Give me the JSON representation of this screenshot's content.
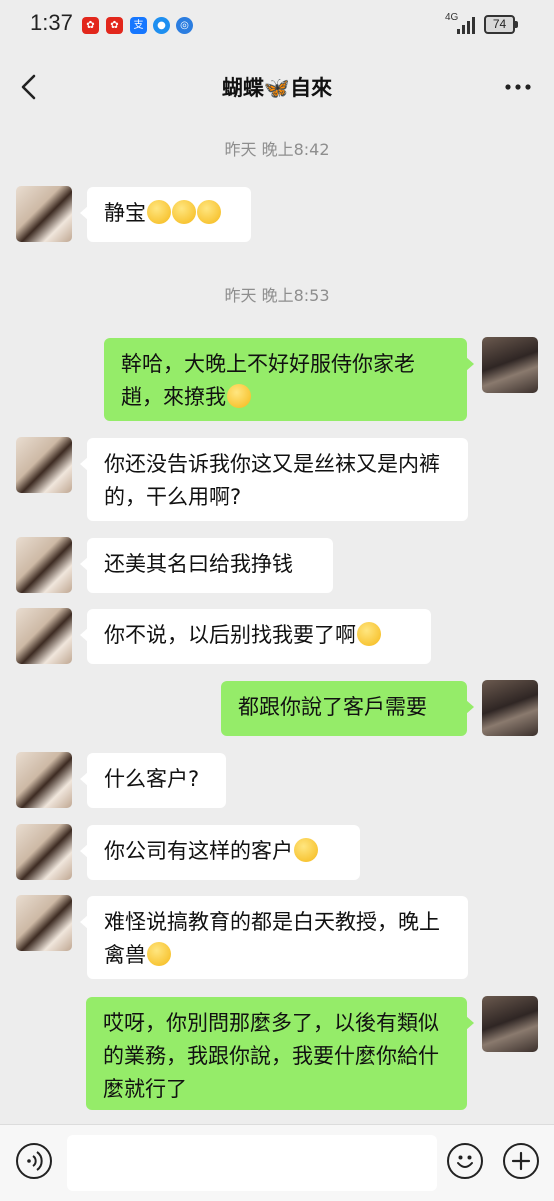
{
  "status_bar": {
    "time": "1:37",
    "network": "4G",
    "battery": "74"
  },
  "header": {
    "title": "蝴蝶🦋自來",
    "back_icon": "chevron-left-icon",
    "more_icon": "more-dots-icon"
  },
  "timestamps": [
    "昨天 晚上8:42",
    "昨天 晚上8:53"
  ],
  "messages": [
    {
      "side": "in",
      "text": "静宝",
      "emoji": [
        "kiss-face",
        "kiss-face",
        "kiss-face"
      ]
    },
    {
      "side": "out",
      "text": "幹哈，大晚上不好好服侍你家老趙，來撩我",
      "emoji": [
        "rolling-eyes-face"
      ]
    },
    {
      "side": "in",
      "text": "你还没告诉我你这又是丝袜又是内裤的，干么用啊?"
    },
    {
      "side": "in",
      "text": "还美其名曰给我挣钱"
    },
    {
      "side": "in",
      "text": "你不说，以后别找我要了啊",
      "emoji": [
        "thinking-face"
      ]
    },
    {
      "side": "out",
      "text": "都跟你說了客戶需要"
    },
    {
      "side": "in",
      "text": "什么客户?"
    },
    {
      "side": "in",
      "text": "你公司有这样的客户",
      "emoji": [
        "screaming-face"
      ]
    },
    {
      "side": "in",
      "text": "难怪说搞教育的都是白天教授，晚上禽兽",
      "emoji": [
        "tears-of-joy-face"
      ]
    },
    {
      "side": "out",
      "text": "哎呀，你別問那麼多了，以後有類似的業務，我跟你說，我要什麼你給什麼就行了"
    }
  ],
  "input_bar": {
    "voice_icon": "voice-icon",
    "emoji_icon": "emoji-icon",
    "plus_icon": "plus-icon",
    "placeholder": ""
  },
  "colors": {
    "outgoing_bubble": "#95ec69",
    "incoming_bubble": "#ffffff",
    "background": "#ededed"
  }
}
